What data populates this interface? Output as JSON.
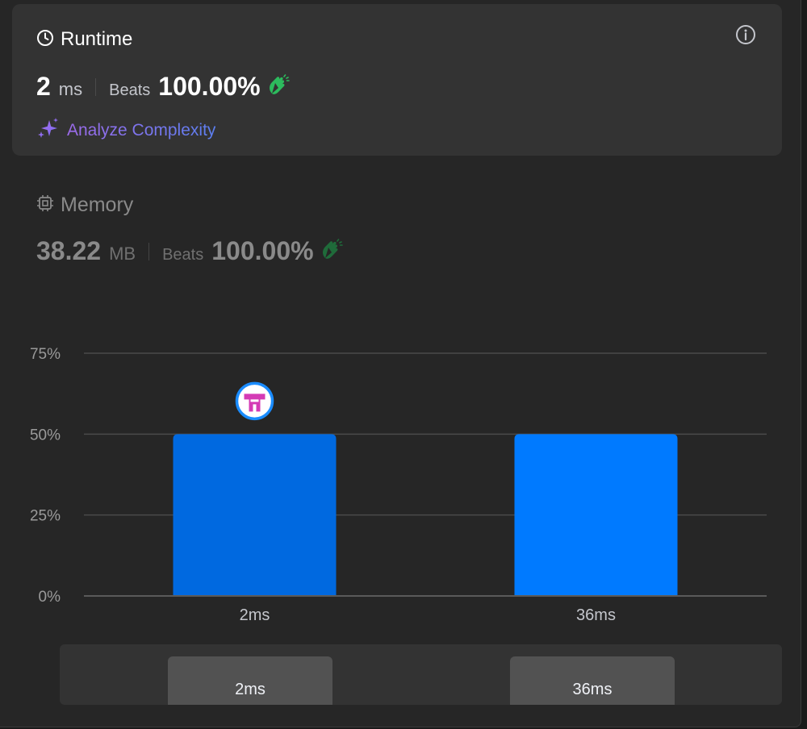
{
  "runtime": {
    "title": "Runtime",
    "value": "2",
    "unit": "ms",
    "beats_label": "Beats",
    "beats_value": "100.00%",
    "analyze_label": "Analyze Complexity"
  },
  "memory": {
    "title": "Memory",
    "value": "38.22",
    "unit": "MB",
    "beats_label": "Beats",
    "beats_value": "100.00%"
  },
  "colors": {
    "bar_highlight": "#0069e0",
    "bar_normal": "#007aff",
    "clap_green": "#2cbb5d",
    "card_bg": "#333333"
  },
  "icons": [
    "clock-icon",
    "info-icon",
    "clap-icon",
    "sparkle-icon",
    "chip-icon",
    "avatar"
  ],
  "chart_data": {
    "type": "bar",
    "categories": [
      "2ms",
      "36ms"
    ],
    "values": [
      50,
      50
    ],
    "y_ticks": [
      "75%",
      "50%",
      "25%",
      "0%"
    ],
    "y_tick_values": [
      75,
      50,
      25,
      0
    ],
    "ylim": [
      0,
      75
    ],
    "grid": true,
    "highlight_index": 0
  },
  "range_selector": {
    "labels": [
      "2ms",
      "36ms"
    ]
  }
}
